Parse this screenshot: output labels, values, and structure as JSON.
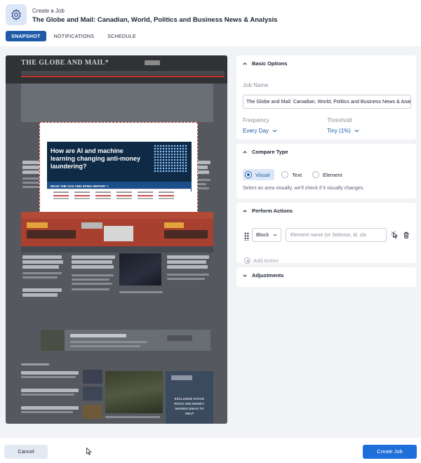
{
  "header": {
    "breadcrumb": "Create a Job",
    "title": "The Globe and Mail: Canadian, World, Politics and Business News & Analysis",
    "app_icon": "gear-icon"
  },
  "tabs": [
    {
      "label": "SNAPSHOT",
      "active": true
    },
    {
      "label": "NOTIFICATIONS",
      "active": false
    },
    {
      "label": "SCHEDULE",
      "active": false
    }
  ],
  "preview": {
    "site_logo": "THE GLOBE AND MAIL*",
    "ad_headline": "How are AI and machine learning changing anti-money laundering?",
    "ad_cta": "READ THE SAS AND KPMG REPORT >",
    "side_ad_text": "EXCLUSIVE STOCK PICKS AND MONEY-MAKING IDEAS TO HELP"
  },
  "basic_options": {
    "heading": "Basic Options",
    "job_name_label": "Job Name",
    "job_name_value": "The Globe and Mail: Canadian, World, Politics and Business News & Analysis",
    "frequency_label": "Frequency",
    "frequency_value": "Every Day",
    "threshold_label": "Threshold",
    "threshold_value": "Tiny (1%)"
  },
  "compare_type": {
    "heading": "Compare Type",
    "options": [
      "Visual",
      "Text",
      "Element"
    ],
    "selected": "Visual",
    "help": "Select an area visually, we'll check if it visually changes."
  },
  "perform_actions": {
    "heading": "Perform Actions",
    "action_type": "Block",
    "element_placeholder": "Element name (or Selector, id, cla",
    "add_action": "Add Action"
  },
  "adjustments": {
    "heading": "Adjustments"
  },
  "footer": {
    "cancel": "Cancel",
    "create": "Create Job"
  },
  "colors": {
    "accent": "#1e5aa8",
    "primary_button": "#1e6fd9",
    "page_bg": "#f1f3f6"
  }
}
